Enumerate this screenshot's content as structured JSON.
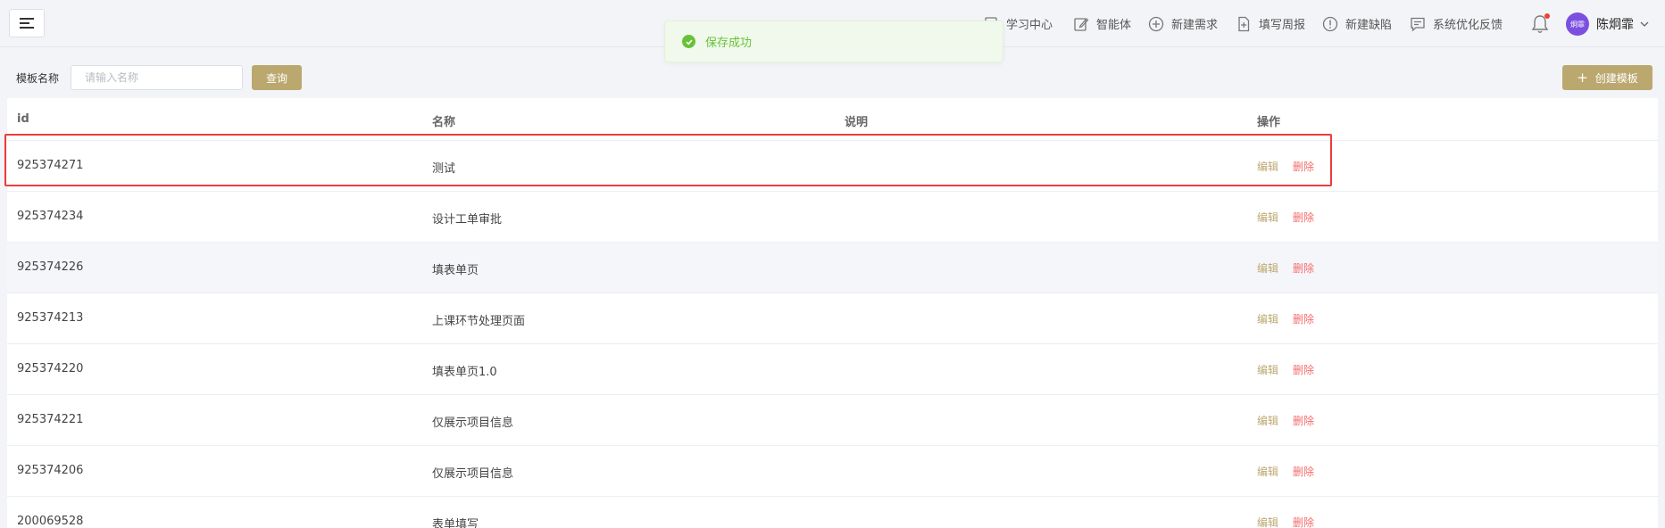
{
  "header": {
    "nav": [
      {
        "label": "学习中心",
        "icon": "book-icon"
      },
      {
        "label": "智能体",
        "icon": "edit-icon"
      },
      {
        "label": "新建需求",
        "icon": "plus-circle-icon"
      },
      {
        "label": "填写周报",
        "icon": "file-plus-icon"
      },
      {
        "label": "新建缺陷",
        "icon": "alert-circle-icon"
      },
      {
        "label": "系统优化反馈",
        "icon": "message-icon"
      }
    ],
    "user": {
      "avatar_text": "炯霏",
      "name": "陈炯霏"
    }
  },
  "toast": {
    "message": "保存成功",
    "type": "success"
  },
  "search": {
    "label": "模板名称",
    "placeholder": "请输入名称",
    "query_button": "查询",
    "create_button": "创建模板"
  },
  "table": {
    "columns": [
      "id",
      "名称",
      "说明",
      "操作"
    ],
    "rows": [
      {
        "id": "925374271",
        "name": "测试",
        "desc": "",
        "edit": "编辑",
        "delete": "删除"
      },
      {
        "id": "925374234",
        "name": "设计工单审批",
        "desc": "",
        "edit": "编辑",
        "delete": "删除"
      },
      {
        "id": "925374226",
        "name": "填表单页",
        "desc": "",
        "edit": "编辑",
        "delete": "删除"
      },
      {
        "id": "925374213",
        "name": "上课环节处理页面",
        "desc": "",
        "edit": "编辑",
        "delete": "删除"
      },
      {
        "id": "925374220",
        "name": "填表单页1.0",
        "desc": "",
        "edit": "编辑",
        "delete": "删除"
      },
      {
        "id": "925374221",
        "name": "仅展示项目信息",
        "desc": "",
        "edit": "编辑",
        "delete": "删除"
      },
      {
        "id": "925374206",
        "name": "仅展示项目信息",
        "desc": "",
        "edit": "编辑",
        "delete": "删除"
      },
      {
        "id": "200069528",
        "name": "表单填写",
        "desc": "",
        "edit": "编辑",
        "delete": "删除"
      }
    ]
  },
  "colors": {
    "accent": "#bba86f",
    "danger": "#f56c6c",
    "success": "#67c23a",
    "highlight": "#ee3b3b"
  }
}
